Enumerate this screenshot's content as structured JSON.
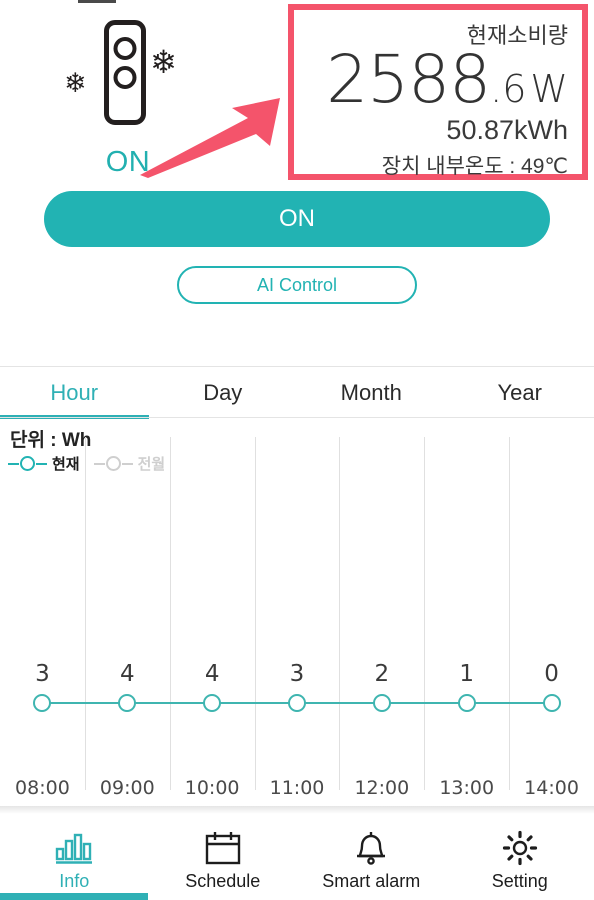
{
  "device": {
    "icon_name": "air-conditioner-icon",
    "snowflake_glyph": "❄",
    "state_label": "ON"
  },
  "power_panel": {
    "title": "현재소비량",
    "value_integer": "2588",
    "value_fraction": ".6",
    "value_unit": "W",
    "energy": "50.87kWh",
    "temperature": "장치 내부온도 : 49℃",
    "highlight_color": "#f4546b"
  },
  "annotation": {
    "arrow_color": "#f4546b",
    "arrow_name": "red-pointer-arrow"
  },
  "controls": {
    "power_button_label": "ON",
    "ai_button_label": "AI Control",
    "accent_color": "#22b3b3"
  },
  "tabs": [
    {
      "label": "Hour",
      "active": true
    },
    {
      "label": "Day",
      "active": false
    },
    {
      "label": "Month",
      "active": false
    },
    {
      "label": "Year",
      "active": false
    }
  ],
  "chart_data": {
    "type": "line",
    "title": "",
    "unit_label": "단위 : Wh",
    "xlabel": "",
    "ylabel": "Wh",
    "grid": true,
    "legend_position": "top-left",
    "categories": [
      "08:00",
      "09:00",
      "10:00",
      "11:00",
      "12:00",
      "13:00",
      "14:00"
    ],
    "series": [
      {
        "name": "현재",
        "color": "#22b3b3",
        "active": true,
        "values": [
          3,
          4,
          4,
          3,
          2,
          1,
          0
        ]
      },
      {
        "name": "전월",
        "color": "#cfcfcf",
        "active": false,
        "values": []
      }
    ],
    "point_labels": [
      "3",
      "4",
      "4",
      "3",
      "2",
      "1",
      "0"
    ]
  },
  "bottom_nav": [
    {
      "label": "Info",
      "icon": "bar-chart-icon",
      "active": true
    },
    {
      "label": "Schedule",
      "icon": "calendar-icon",
      "active": false
    },
    {
      "label": "Smart alarm",
      "icon": "bell-icon",
      "active": false
    },
    {
      "label": "Setting",
      "icon": "gear-icon",
      "active": false
    }
  ]
}
